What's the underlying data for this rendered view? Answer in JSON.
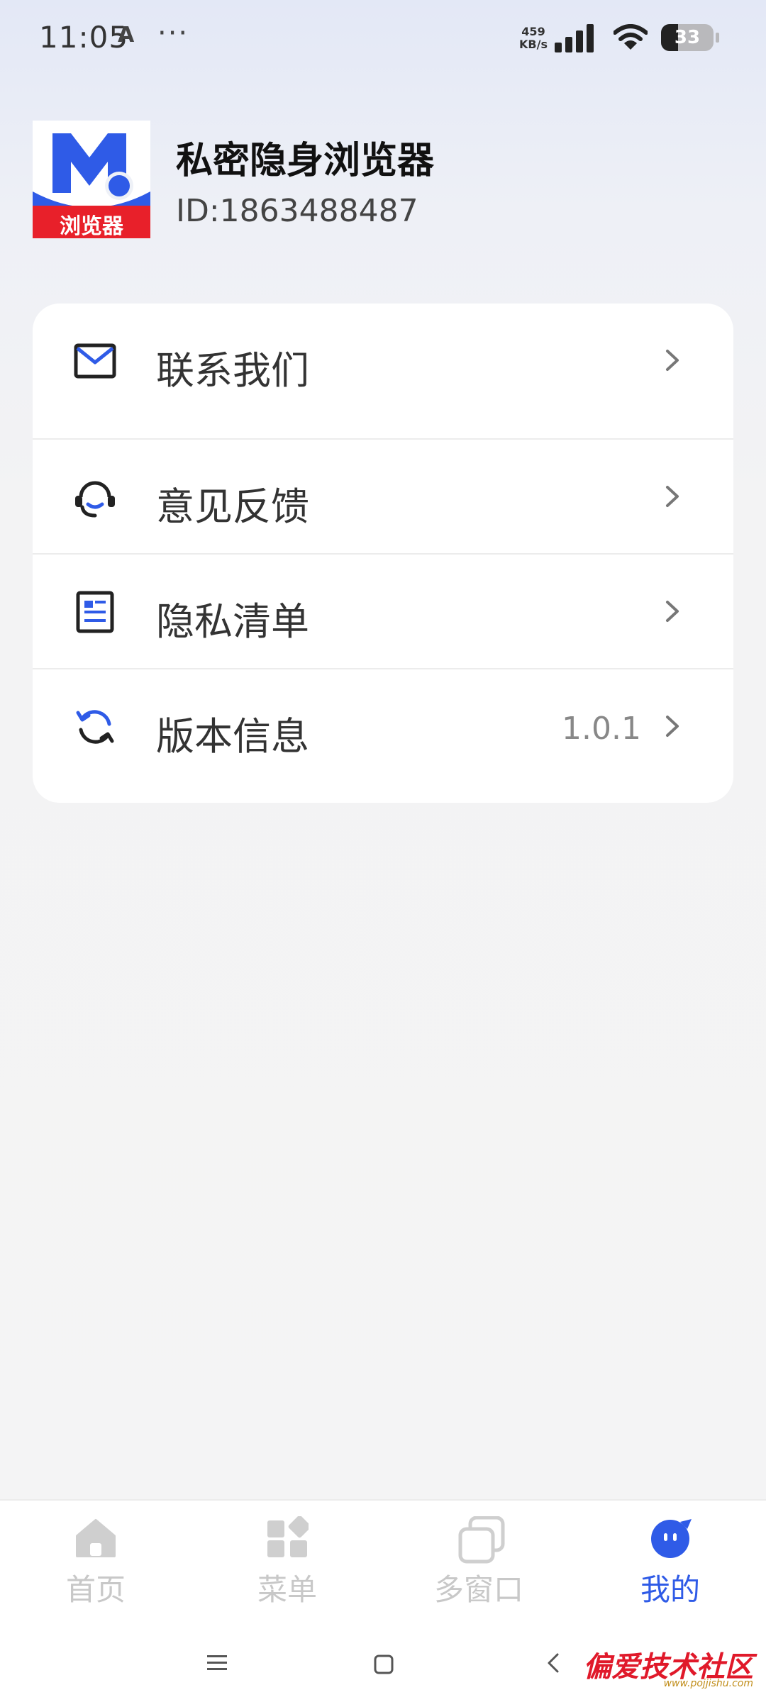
{
  "status_bar": {
    "time": "11:05",
    "notif_icon": "A",
    "dots": "···",
    "net_speed_value": "459",
    "net_speed_unit": "KB/s",
    "battery_level": "33"
  },
  "profile": {
    "logo_text": "浏览器",
    "app_name": "私密隐身浏览器",
    "id_text": "ID:1863488487"
  },
  "menu": {
    "items": [
      {
        "label": "联系我们",
        "icon": "mail-icon"
      },
      {
        "label": "意见反馈",
        "icon": "headset-icon"
      },
      {
        "label": "隐私清单",
        "icon": "document-list-icon"
      },
      {
        "label": "版本信息",
        "icon": "refresh-icon",
        "value": "1.0.1"
      }
    ]
  },
  "bottom_nav": {
    "items": [
      {
        "label": "首页",
        "icon": "home-icon",
        "active": false
      },
      {
        "label": "菜单",
        "icon": "grid-menu-icon",
        "active": false
      },
      {
        "label": "多窗口",
        "icon": "multi-window-icon",
        "active": false
      },
      {
        "label": "我的",
        "icon": "profile-face-icon",
        "active": true
      }
    ]
  },
  "colors": {
    "accent": "#2f5be7",
    "inactive": "#c8c8c8",
    "logo_red": "#e8202a"
  },
  "watermark": {
    "text": "偏爱技术社区",
    "url": "www.pojjishu.com"
  }
}
